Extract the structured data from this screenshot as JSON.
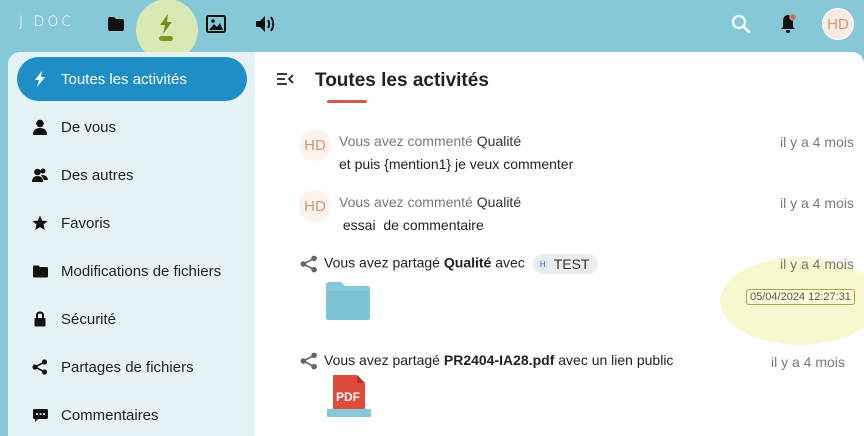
{
  "header": {
    "logo": "J DOC",
    "avatar_initials": "HD",
    "apps": [
      "files-icon",
      "activity-icon",
      "photos-icon",
      "audio-icon"
    ]
  },
  "sidebar": {
    "items": [
      {
        "label": "Toutes les activités",
        "icon": "lightning-icon",
        "active": true
      },
      {
        "label": "De vous",
        "icon": "user-icon"
      },
      {
        "label": "Des autres",
        "icon": "users-icon"
      },
      {
        "label": "Favoris",
        "icon": "star-icon"
      },
      {
        "label": "Modifications de fichiers",
        "icon": "folder-icon"
      },
      {
        "label": "Sécurité",
        "icon": "lock-icon"
      },
      {
        "label": "Partages de fichiers",
        "icon": "share-icon"
      },
      {
        "label": "Commentaires",
        "icon": "comment-icon"
      }
    ]
  },
  "main": {
    "title": "Toutes les activités",
    "activities": [
      {
        "avatar": "HD",
        "action": "Vous avez commenté",
        "object": "Qualité",
        "detail": "et puis {mention1} je veux commenter",
        "time": "il y a 4 mois"
      },
      {
        "avatar": "HD",
        "action": "Vous avez commenté",
        "object": "Qualité",
        "detail": " essai  de commentaire",
        "time": "il y a 4 mois"
      },
      {
        "prefix": "Vous avez partagé",
        "object": "Qualité",
        "middle": "avec",
        "chip_badge": "H",
        "chip_label": "TEST",
        "time": "il y a 4 mois",
        "tooltip": "05/04/2024 12:27:31",
        "preview": "folder-icon"
      },
      {
        "prefix": "Vous avez partagé",
        "object": "PR2404-IA28.pdf",
        "suffix": "avec un lien public",
        "time": "il y a 4 mois",
        "preview_label": "PDF"
      }
    ]
  },
  "colors": {
    "topbar": "#85c9d9",
    "accent": "#1f8dc6",
    "sidebar": "#e6f3f6",
    "pdf": "#e04a3a",
    "folder": "#85c9d9"
  }
}
